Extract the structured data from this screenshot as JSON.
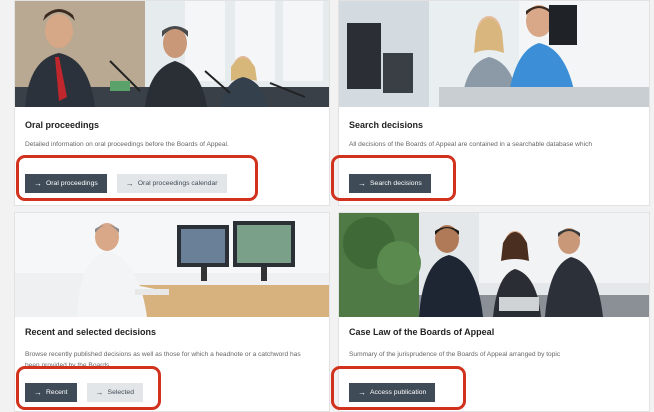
{
  "cards": [
    {
      "title": "Oral proceedings",
      "description": "Detailed information on oral proceedings before the Boards of Appeal.",
      "buttons": [
        {
          "label": "Oral proceedings",
          "style": "dark"
        },
        {
          "label": "Oral proceedings calendar",
          "style": "light"
        }
      ]
    },
    {
      "title": "Search decisions",
      "description": "All decisions of the Boards of Appeal are contained in a searchable database which",
      "buttons": [
        {
          "label": "Search decisions",
          "style": "dark"
        }
      ]
    },
    {
      "title": "Recent and selected decisions",
      "description": "Browse recently published decisions as well as those for which a headnote or a catchword has been provided by the Boards.",
      "buttons": [
        {
          "label": "Recent",
          "style": "dark"
        },
        {
          "label": "Selected",
          "style": "light"
        }
      ]
    },
    {
      "title": "Case Law of the Boards of Appeal",
      "description": "Summary of the jurisprudence of the Boards of Appeal arranged by topic",
      "buttons": [
        {
          "label": "Access publication",
          "style": "dark"
        }
      ]
    }
  ],
  "icons": {
    "button_arrow": "arrow-right-icon"
  },
  "colors": {
    "highlight": "#d1321e",
    "button_dark": "#3f4b57",
    "button_light": "#e3e6e9"
  }
}
